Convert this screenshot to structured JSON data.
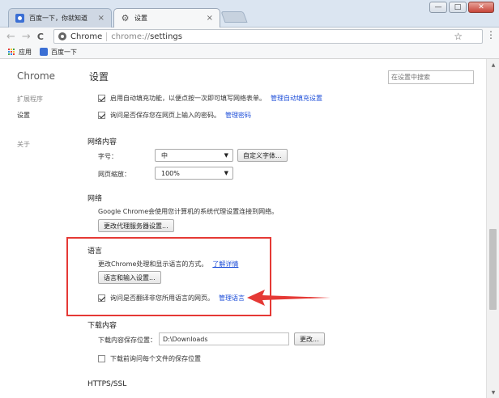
{
  "tabs": [
    {
      "label": "百度一下，你就知道",
      "close": "×"
    },
    {
      "label": "设置",
      "close": "×"
    }
  ],
  "window_controls": {
    "minimize": "—",
    "maximize": "□",
    "close": "✕"
  },
  "toolbar": {
    "back": "←",
    "forward": "→",
    "reload": "C",
    "omnibox_brand": "Chrome",
    "url_scheme": "chrome://",
    "url_path": "settings",
    "star": "☆",
    "menu": "⋮"
  },
  "bookmarks": [
    {
      "label": "应用"
    },
    {
      "label": "百度一下"
    }
  ],
  "sidebar": {
    "title": "Chrome",
    "items": [
      {
        "label": "扩展程序"
      },
      {
        "label": "设置"
      },
      {
        "label": "关于"
      }
    ]
  },
  "header": {
    "title": "设置",
    "search_placeholder": "在设置中搜索"
  },
  "passwords": {
    "autofill_label": "启用自动填充功能，以便点按一次即可填写网络表单。",
    "autofill_link": "管理自动填充设置",
    "save_label": "询问是否保存您在网页上输入的密码。",
    "save_link": "管理密码"
  },
  "web_content": {
    "heading": "网络内容",
    "font_size_label": "字号：",
    "font_size_value": "中",
    "customize_fonts_button": "自定义字体...",
    "zoom_label": "网页缩放：",
    "zoom_value": "100%"
  },
  "network": {
    "heading": "网络",
    "description": "Google Chrome会使用您计算机的系统代理设置连接到网络。",
    "proxy_button": "更改代理服务器设置..."
  },
  "language": {
    "heading": "语言",
    "description": "更改Chrome处理和显示语言的方式。",
    "learn_more": "了解详情",
    "settings_button": "语言和输入设置...",
    "translate_label": "询问是否翻译非您所用语言的网页。",
    "translate_link": "管理语言"
  },
  "downloads": {
    "heading": "下载内容",
    "location_label": "下载内容保存位置：",
    "location_value": "D:\\Downloads",
    "change_button": "更改...",
    "ask_label": "下载前询问每个文件的保存位置"
  },
  "https": {
    "heading": "HTTPS/SSL"
  },
  "colors": {
    "annotation": "#e53935",
    "link": "#1d4ed8"
  }
}
